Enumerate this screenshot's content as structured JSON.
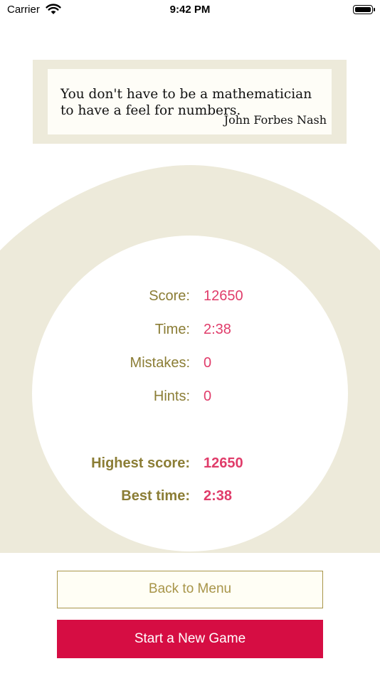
{
  "status_bar": {
    "carrier": "Carrier",
    "time": "9:42 PM"
  },
  "quote": {
    "text": "You don't have to be a mathematician to have a feel for numbers.",
    "author": "John Forbes Nash"
  },
  "stats": [
    {
      "label": "Score:",
      "value": "12650"
    },
    {
      "label": "Time:",
      "value": "2:38"
    },
    {
      "label": "Mistakes:",
      "value": "0"
    },
    {
      "label": "Hints:",
      "value": "0"
    }
  ],
  "records": [
    {
      "label": "Highest score:",
      "value": "12650"
    },
    {
      "label": "Best time:",
      "value": "2:38"
    }
  ],
  "buttons": {
    "back_to_menu": "Back to Menu",
    "new_game": "Start a New Game"
  },
  "colors": {
    "panel_beige": "#edeada",
    "label_olive": "#8b7d35",
    "value_pink": "#e03c6a",
    "primary_button": "#d60d43",
    "secondary_button_border": "#a89549"
  }
}
